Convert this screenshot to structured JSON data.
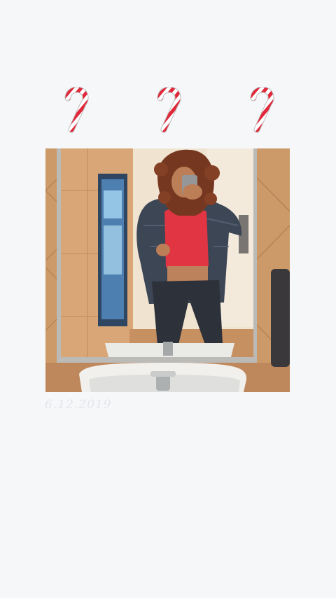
{
  "story": {
    "date_stamp": "6.12.2019",
    "stickers": [
      "candy-cane",
      "candy-cane",
      "candy-cane"
    ],
    "colors": {
      "background": "#f6f7f9",
      "candy_red": "#e0283a",
      "date_text": "#e2e6eb",
      "shirt_red": "#e0283a",
      "tile_tan": "#c58f5f"
    }
  }
}
